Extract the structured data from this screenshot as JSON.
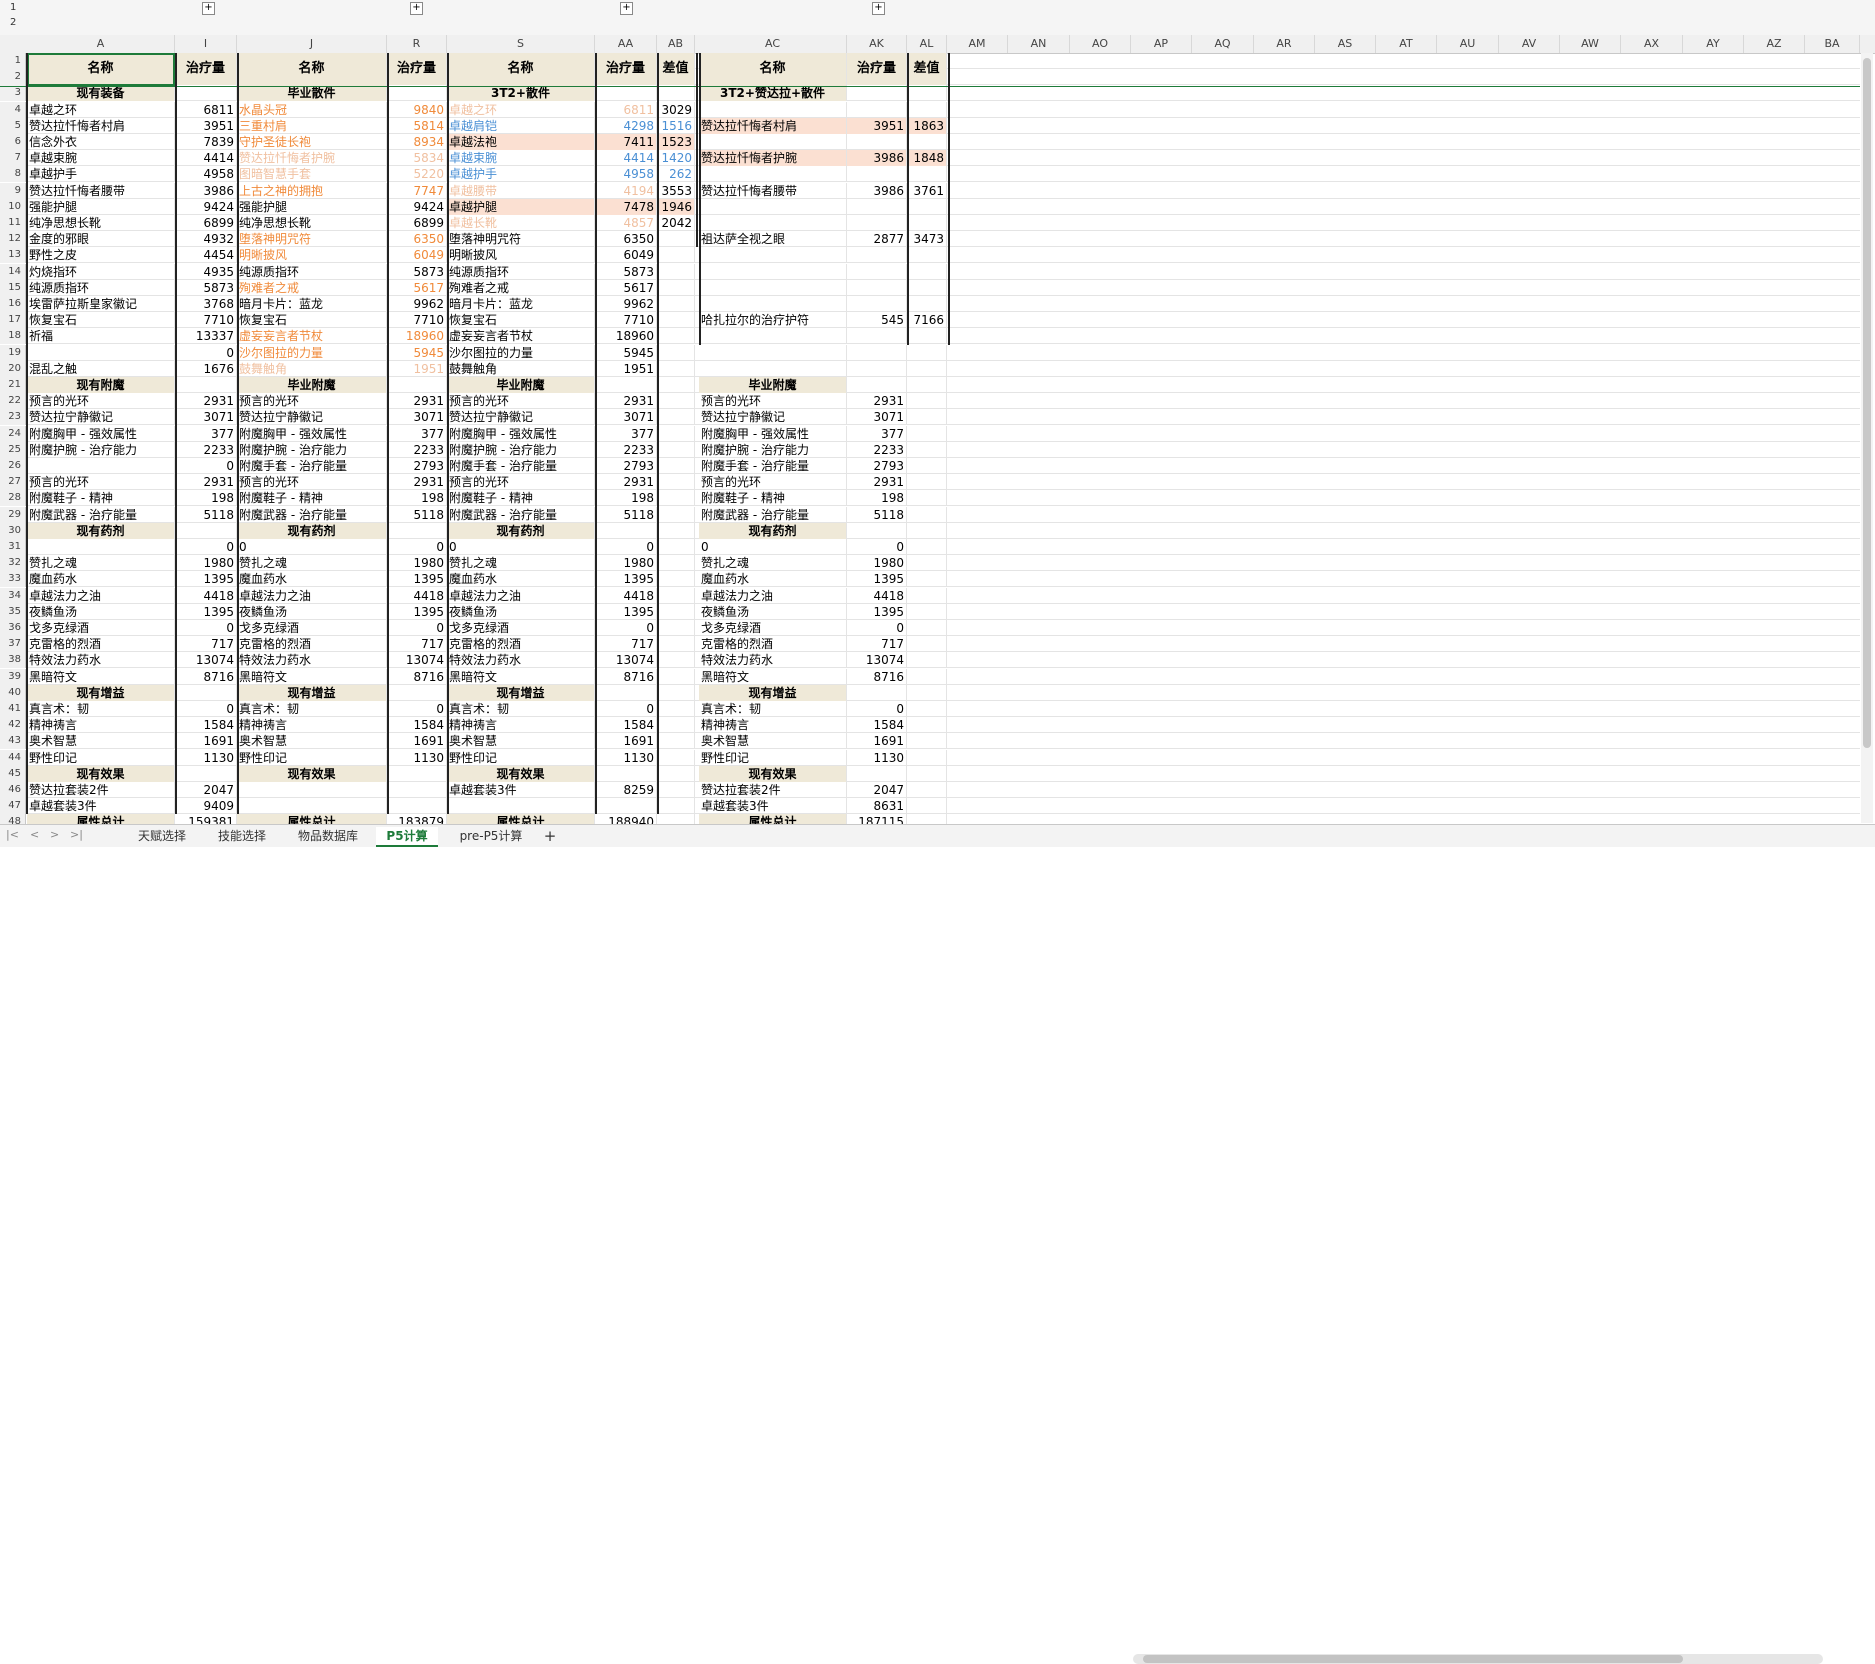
{
  "col_headers": [
    "A",
    "I",
    "J",
    "R",
    "S",
    "AA",
    "AB",
    "AC",
    "AK",
    "AL",
    "AM",
    "AN",
    "AO",
    "AP",
    "AQ",
    "AR",
    "AS",
    "AT",
    "AU",
    "AV",
    "AW",
    "AX",
    "AY",
    "AZ",
    "BA"
  ],
  "group_levels": [
    "1",
    "2"
  ],
  "group_buttons": [
    "+",
    "+",
    "+",
    "+"
  ],
  "header_row": {
    "a": "名称",
    "i": "治疗量",
    "j": "名称",
    "r": "治疗量",
    "s": "名称",
    "aa": "治疗量",
    "ab": "差值",
    "ac": "名称",
    "ak": "治疗量",
    "al": "差值"
  },
  "section_titles": {
    "b1_gear": "现有装备",
    "b2_gear": "毕业散件",
    "b3_gear": "3T2+散件",
    "b4_gear": "3T2+赞达拉+散件",
    "b1_ench": "现有附魔",
    "b2_ench": "毕业附魔",
    "b3_ench": "毕业附魔",
    "b4_ench": "毕业附魔",
    "pots": "现有药剂",
    "buffs": "现有增益",
    "effects": "现有效果",
    "total": "属性总计"
  },
  "rows": [
    {
      "n": "1",
      "a": "",
      "i": "",
      "j": "",
      "r": "",
      "s": "",
      "aa": "",
      "ab": "",
      "ac": "",
      "ak": "",
      "al": ""
    },
    {
      "n": "2",
      "a": "",
      "i": "",
      "j": "",
      "r": "",
      "s": "",
      "aa": "",
      "ab": "",
      "ac": "",
      "ak": "",
      "al": ""
    },
    {
      "n": "3",
      "a": "现有装备",
      "i": "",
      "j": "毕业散件",
      "r": "",
      "s": "3T2+散件",
      "aa": "",
      "ab": "",
      "ac": "3T2+赞达拉+散件",
      "ak": "",
      "al": ""
    },
    {
      "n": "4",
      "a": "卓越之环",
      "i": "6811",
      "j": "水晶头冠",
      "r": "9840",
      "s": "卓越之环",
      "aa": "6811",
      "ab": "3029",
      "ac": "",
      "ak": "",
      "al": ""
    },
    {
      "n": "5",
      "a": "赞达拉忏悔者村肩",
      "i": "3951",
      "j": "三重村肩",
      "r": "5814",
      "s": "卓越肩铠",
      "aa": "4298",
      "ab": "1516",
      "ac": "赞达拉忏悔者村肩",
      "ak": "3951",
      "al": "1863"
    },
    {
      "n": "6",
      "a": "信念外衣",
      "i": "7839",
      "j": "守护圣徒长袍",
      "r": "8934",
      "s": "卓越法袍",
      "aa": "7411",
      "ab": "1523",
      "ac": "",
      "ak": "",
      "al": ""
    },
    {
      "n": "7",
      "a": "卓越束腕",
      "i": "4414",
      "j": "赞达拉忏悔者护腕",
      "r": "5834",
      "s": "卓越束腕",
      "aa": "4414",
      "ab": "1420",
      "ac": "赞达拉忏悔者护腕",
      "ak": "3986",
      "al": "1848"
    },
    {
      "n": "8",
      "a": "卓越护手",
      "i": "4958",
      "j": "图暗智慧手套",
      "r": "5220",
      "s": "卓越护手",
      "aa": "4958",
      "ab": "262",
      "ac": "",
      "ak": "",
      "al": ""
    },
    {
      "n": "9",
      "a": "赞达拉忏悔者腰带",
      "i": "3986",
      "j": "上古之神的拥抱",
      "r": "7747",
      "s": "卓越腰带",
      "aa": "4194",
      "ab": "3553",
      "ac": "赞达拉忏悔者腰带",
      "ak": "3986",
      "al": "3761"
    },
    {
      "n": "10",
      "a": "强能护腿",
      "i": "9424",
      "j": "强能护腿",
      "r": "9424",
      "s": "卓越护腿",
      "aa": "7478",
      "ab": "1946",
      "ac": "",
      "ak": "",
      "al": ""
    },
    {
      "n": "11",
      "a": "纯净思想长靴",
      "i": "6899",
      "j": "纯净思想长靴",
      "r": "6899",
      "s": "卓越长靴",
      "aa": "4857",
      "ab": "2042",
      "ac": "",
      "ak": "",
      "al": ""
    },
    {
      "n": "12",
      "a": "金度的邪眼",
      "i": "4932",
      "j": "堕落神明咒符",
      "r": "6350",
      "s": "堕落神明咒符",
      "aa": "6350",
      "ab": "",
      "ac": "祖达萨全视之眼",
      "ak": "2877",
      "al": "3473"
    },
    {
      "n": "13",
      "a": "野性之皮",
      "i": "4454",
      "j": "明晰披风",
      "r": "6049",
      "s": "明晰披风",
      "aa": "6049",
      "ab": "",
      "ac": "",
      "ak": "",
      "al": ""
    },
    {
      "n": "14",
      "a": "灼烧指环",
      "i": "4935",
      "j": "纯源质指环",
      "r": "5873",
      "s": "纯源质指环",
      "aa": "5873",
      "ab": "",
      "ac": "",
      "ak": "",
      "al": ""
    },
    {
      "n": "15",
      "a": "纯源质指环",
      "i": "5873",
      "j": "殉难者之戒",
      "r": "5617",
      "s": "殉难者之戒",
      "aa": "5617",
      "ab": "",
      "ac": "",
      "ak": "",
      "al": ""
    },
    {
      "n": "16",
      "a": "埃雷萨拉斯皇家徽记",
      "i": "3768",
      "j": "暗月卡片：蓝龙",
      "r": "9962",
      "s": "暗月卡片：蓝龙",
      "aa": "9962",
      "ab": "",
      "ac": "",
      "ak": "",
      "al": ""
    },
    {
      "n": "17",
      "a": "恢复宝石",
      "i": "7710",
      "j": "恢复宝石",
      "r": "7710",
      "s": "恢复宝石",
      "aa": "7710",
      "ab": "",
      "ac": "哈扎拉尔的治疗护符",
      "ak": "545",
      "al": "7166"
    },
    {
      "n": "18",
      "a": "祈福",
      "i": "13337",
      "j": "虚妄妄言者节杖",
      "r": "18960",
      "s": "虚妄妄言者节杖",
      "aa": "18960",
      "ab": "",
      "ac": "",
      "ak": "",
      "al": ""
    },
    {
      "n": "19",
      "a": "",
      "i": "0",
      "j": "沙尔图拉的力量",
      "r": "5945",
      "s": "沙尔图拉的力量",
      "aa": "5945",
      "ab": "",
      "ac": "",
      "ak": "",
      "al": ""
    },
    {
      "n": "20",
      "a": "混乱之触",
      "i": "1676",
      "j": "鼓舞触角",
      "r": "1951",
      "s": "鼓舞触角",
      "aa": "1951",
      "ab": "",
      "ac": "",
      "ak": "",
      "al": ""
    },
    {
      "n": "21",
      "a": "现有附魔",
      "i": "",
      "j": "毕业附魔",
      "r": "",
      "s": "毕业附魔",
      "aa": "",
      "ab": "",
      "ac": "毕业附魔",
      "ak": "",
      "al": ""
    },
    {
      "n": "22",
      "a": "预言的光环",
      "i": "2931",
      "j": "预言的光环",
      "r": "2931",
      "s": "预言的光环",
      "aa": "2931",
      "ab": "",
      "ac": "预言的光环",
      "ak": "2931",
      "al": ""
    },
    {
      "n": "23",
      "a": "赞达拉宁静徽记",
      "i": "3071",
      "j": "赞达拉宁静徽记",
      "r": "3071",
      "s": "赞达拉宁静徽记",
      "aa": "3071",
      "ab": "",
      "ac": "赞达拉宁静徽记",
      "ak": "3071",
      "al": ""
    },
    {
      "n": "24",
      "a": "附魔胸甲 - 强效属性",
      "i": "377",
      "j": "附魔胸甲 - 强效属性",
      "r": "377",
      "s": "附魔胸甲 - 强效属性",
      "aa": "377",
      "ab": "",
      "ac": "附魔胸甲 - 强效属性",
      "ak": "377",
      "al": ""
    },
    {
      "n": "25",
      "a": "附魔护腕 - 治疗能力",
      "i": "2233",
      "j": "附魔护腕 - 治疗能力",
      "r": "2233",
      "s": "附魔护腕 - 治疗能力",
      "aa": "2233",
      "ab": "",
      "ac": "附魔护腕 - 治疗能力",
      "ak": "2233",
      "al": ""
    },
    {
      "n": "26",
      "a": "",
      "i": "0",
      "j": "附魔手套 - 治疗能量",
      "r": "2793",
      "s": "附魔手套 - 治疗能量",
      "aa": "2793",
      "ab": "",
      "ac": "附魔手套 - 治疗能量",
      "ak": "2793",
      "al": ""
    },
    {
      "n": "27",
      "a": "预言的光环",
      "i": "2931",
      "j": "预言的光环",
      "r": "2931",
      "s": "预言的光环",
      "aa": "2931",
      "ab": "",
      "ac": "预言的光环",
      "ak": "2931",
      "al": ""
    },
    {
      "n": "28",
      "a": "附魔鞋子 - 精神",
      "i": "198",
      "j": "附魔鞋子 - 精神",
      "r": "198",
      "s": "附魔鞋子 - 精神",
      "aa": "198",
      "ab": "",
      "ac": "附魔鞋子 - 精神",
      "ak": "198",
      "al": ""
    },
    {
      "n": "29",
      "a": "附魔武器 - 治疗能量",
      "i": "5118",
      "j": "附魔武器 - 治疗能量",
      "r": "5118",
      "s": "附魔武器 - 治疗能量",
      "aa": "5118",
      "ab": "",
      "ac": "附魔武器 - 治疗能量",
      "ak": "5118",
      "al": ""
    },
    {
      "n": "30",
      "a": "现有药剂",
      "i": "",
      "j": "现有药剂",
      "r": "",
      "s": "现有药剂",
      "aa": "",
      "ab": "",
      "ac": "现有药剂",
      "ak": "",
      "al": ""
    },
    {
      "n": "31",
      "a": "",
      "i": "0",
      "j": "0",
      "r": "0",
      "s": "0",
      "aa": "0",
      "ab": "",
      "ac": "0",
      "ak": "0",
      "al": ""
    },
    {
      "n": "32",
      "a": "赞扎之魂",
      "i": "1980",
      "j": "赞扎之魂",
      "r": "1980",
      "s": "赞扎之魂",
      "aa": "1980",
      "ab": "",
      "ac": "赞扎之魂",
      "ak": "1980",
      "al": ""
    },
    {
      "n": "33",
      "a": "魔血药水",
      "i": "1395",
      "j": "魔血药水",
      "r": "1395",
      "s": "魔血药水",
      "aa": "1395",
      "ab": "",
      "ac": "魔血药水",
      "ak": "1395",
      "al": ""
    },
    {
      "n": "34",
      "a": "卓越法力之油",
      "i": "4418",
      "j": "卓越法力之油",
      "r": "4418",
      "s": "卓越法力之油",
      "aa": "4418",
      "ab": "",
      "ac": "卓越法力之油",
      "ak": "4418",
      "al": ""
    },
    {
      "n": "35",
      "a": "夜鳞鱼汤",
      "i": "1395",
      "j": "夜鳞鱼汤",
      "r": "1395",
      "s": "夜鳞鱼汤",
      "aa": "1395",
      "ab": "",
      "ac": "夜鳞鱼汤",
      "ak": "1395",
      "al": ""
    },
    {
      "n": "36",
      "a": "戈多克绿酒",
      "i": "0",
      "j": "戈多克绿酒",
      "r": "0",
      "s": "戈多克绿酒",
      "aa": "0",
      "ab": "",
      "ac": "戈多克绿酒",
      "ak": "0",
      "al": ""
    },
    {
      "n": "37",
      "a": "克雷格的烈酒",
      "i": "717",
      "j": "克雷格的烈酒",
      "r": "717",
      "s": "克雷格的烈酒",
      "aa": "717",
      "ab": "",
      "ac": "克雷格的烈酒",
      "ak": "717",
      "al": ""
    },
    {
      "n": "38",
      "a": "特效法力药水",
      "i": "13074",
      "j": "特效法力药水",
      "r": "13074",
      "s": "特效法力药水",
      "aa": "13074",
      "ab": "",
      "ac": "特效法力药水",
      "ak": "13074",
      "al": ""
    },
    {
      "n": "39",
      "a": "黑暗符文",
      "i": "8716",
      "j": "黑暗符文",
      "r": "8716",
      "s": "黑暗符文",
      "aa": "8716",
      "ab": "",
      "ac": "黑暗符文",
      "ak": "8716",
      "al": ""
    },
    {
      "n": "40",
      "a": "现有增益",
      "i": "",
      "j": "现有增益",
      "r": "",
      "s": "现有增益",
      "aa": "",
      "ab": "",
      "ac": "现有增益",
      "ak": "",
      "al": ""
    },
    {
      "n": "41",
      "a": "真言术：韧",
      "i": "0",
      "j": "真言术：韧",
      "r": "0",
      "s": "真言术：韧",
      "aa": "0",
      "ab": "",
      "ac": "真言术：韧",
      "ak": "0",
      "al": ""
    },
    {
      "n": "42",
      "a": "精神祷言",
      "i": "1584",
      "j": "精神祷言",
      "r": "1584",
      "s": "精神祷言",
      "aa": "1584",
      "ab": "",
      "ac": "精神祷言",
      "ak": "1584",
      "al": ""
    },
    {
      "n": "43",
      "a": "奥术智慧",
      "i": "1691",
      "j": "奥术智慧",
      "r": "1691",
      "s": "奥术智慧",
      "aa": "1691",
      "ab": "",
      "ac": "奥术智慧",
      "ak": "1691",
      "al": ""
    },
    {
      "n": "44",
      "a": "野性印记",
      "i": "1130",
      "j": "野性印记",
      "r": "1130",
      "s": "野性印记",
      "aa": "1130",
      "ab": "",
      "ac": "野性印记",
      "ak": "1130",
      "al": ""
    },
    {
      "n": "45",
      "a": "现有效果",
      "i": "",
      "j": "现有效果",
      "r": "",
      "s": "现有效果",
      "aa": "",
      "ab": "",
      "ac": "现有效果",
      "ak": "",
      "al": ""
    },
    {
      "n": "46",
      "a": "赞达拉套装2件",
      "i": "2047",
      "j": "",
      "r": "",
      "s": "卓越套装3件",
      "aa": "8259",
      "ab": "",
      "ac": "赞达拉套装2件",
      "ak": "2047",
      "al": ""
    },
    {
      "n": "47",
      "a": "卓越套装3件",
      "i": "9409",
      "j": "",
      "r": "",
      "s": "",
      "aa": "",
      "ab": "",
      "ac": "卓越套装3件",
      "ak": "8631",
      "al": ""
    },
    {
      "n": "48",
      "a": "属性总计",
      "i": "159381",
      "j": "属性总计",
      "r": "183879",
      "s": "属性总计",
      "aa": "188940",
      "ab": "",
      "ac": "属性总计",
      "ak": "187115",
      "al": ""
    }
  ],
  "sheet_tabs": [
    {
      "label": "天赋选择",
      "active": false
    },
    {
      "label": "技能选择",
      "active": false
    },
    {
      "label": "物品数据库",
      "active": false
    },
    {
      "label": "P5计算",
      "active": true
    },
    {
      "label": "pre-P5计算",
      "active": false
    }
  ],
  "add_sheet_label": "+",
  "nav_arrows": [
    "|<",
    "<",
    ">",
    ">|"
  ],
  "colors": {
    "accent": "#1e7b3a",
    "header_fill": "#efe9d8",
    "orange_text": "#f08a3a",
    "blue_text": "#4a8fd4",
    "faded_text": "#f0c0a0",
    "pink_fill": "#fbe0d2"
  }
}
